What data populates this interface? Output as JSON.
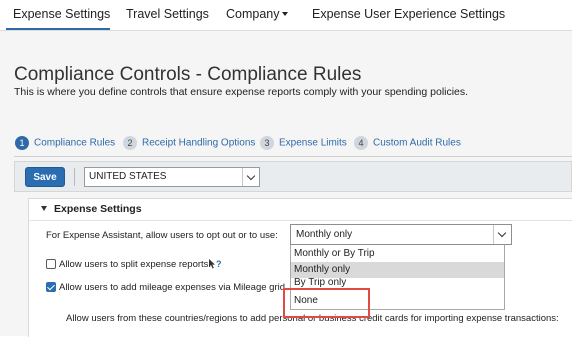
{
  "topnav": {
    "items": [
      {
        "label": "Expense Settings"
      },
      {
        "label": "Travel Settings"
      },
      {
        "label": "Company"
      },
      {
        "label": "Expense User Experience Settings"
      }
    ]
  },
  "header": {
    "title": "Compliance Controls - Compliance Rules",
    "subtitle": "This is where you define controls that ensure expense reports comply with your spending policies."
  },
  "steps": [
    {
      "num": "1",
      "label": "Compliance Rules",
      "active": true
    },
    {
      "num": "2",
      "label": "Receipt Handling Options",
      "active": false
    },
    {
      "num": "3",
      "label": "Expense Limits",
      "active": false
    },
    {
      "num": "4",
      "label": "Custom Audit Rules",
      "active": false
    }
  ],
  "toolbar": {
    "save_label": "Save",
    "country_value": "UNITED STATES"
  },
  "panel": {
    "header": "Expense Settings",
    "optout_label": "For Expense Assistant, allow users to opt out or to use:",
    "optout_value": "Monthly only",
    "dropdown_options": [
      {
        "label": "Monthly or By Trip",
        "selected": false
      },
      {
        "label": "Monthly only",
        "selected": true
      },
      {
        "label": "By Trip only",
        "selected": false
      },
      {
        "label": "None",
        "selected": false
      }
    ],
    "split_label": "Allow users to split expense reports.",
    "split_checked": false,
    "mileage_label": "Allow users to add mileage expenses via Mileage grid",
    "mileage_checked": true,
    "import_label": "Allow users from these countries/regions to add personal or business credit cards for importing expense transactions:"
  },
  "colors": {
    "accent": "#2a6db0",
    "highlight": "#e04b43"
  }
}
